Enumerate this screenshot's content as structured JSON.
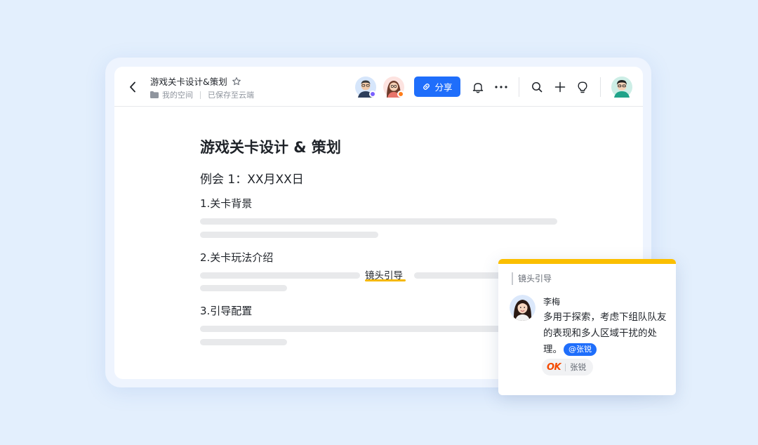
{
  "document": {
    "title": "游戏关卡设计&策划",
    "breadcrumb_space": "我的空间",
    "save_status": "已保存至云端"
  },
  "toolbar": {
    "share_label": "分享",
    "icons": [
      "bell-icon",
      "more-icon",
      "search-icon",
      "plus-icon",
      "lightbulb-icon"
    ]
  },
  "content": {
    "heading": "游戏关卡设计 & 策划",
    "meeting": "例会 1：XX月XX日",
    "section1": "1.关卡背景",
    "section2": "2.关卡玩法介绍",
    "section3": "3.引导配置",
    "highlight": "镜头引导"
  },
  "comment": {
    "quote": "镜头引导",
    "author": "李梅",
    "text": "多用于探索，考虑下组队队友的表现和多人区域干扰的处理。",
    "mention": "@张锐",
    "reaction_emoji": "OK",
    "reaction_user": "张锐"
  },
  "colors": {
    "accent": "#1f6efb",
    "highlight": "#f5b800",
    "card_top": "#fbbf00",
    "background": "#e3effd"
  }
}
